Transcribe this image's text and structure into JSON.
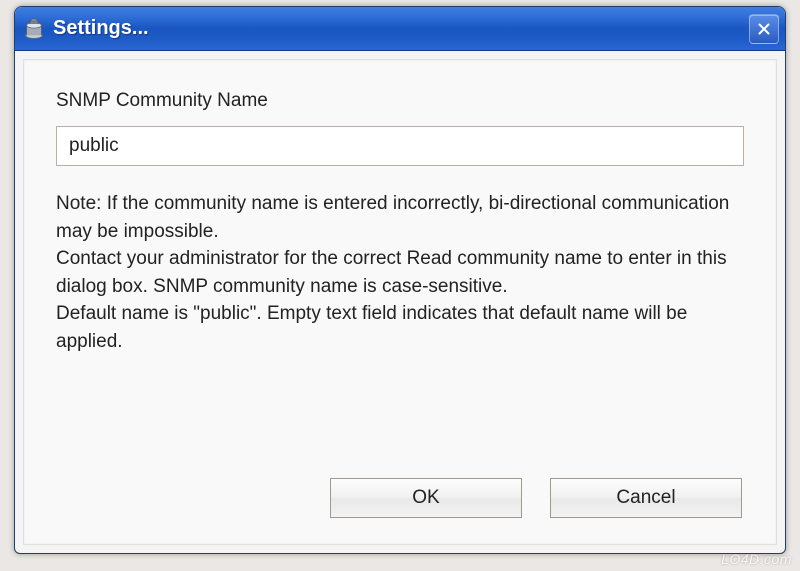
{
  "window": {
    "title": "Settings..."
  },
  "form": {
    "label": "SNMP Community Name",
    "value": "public"
  },
  "note": "Note: If the community name is entered incorrectly, bi-directional communication may be impossible.\nContact your administrator for the correct Read community name to enter in this dialog box. SNMP community name is case-sensitive.\nDefault name is \"public\". Empty text field indicates that default name will be applied.",
  "buttons": {
    "ok": "OK",
    "cancel": "Cancel"
  },
  "watermark": "LO4D.com"
}
